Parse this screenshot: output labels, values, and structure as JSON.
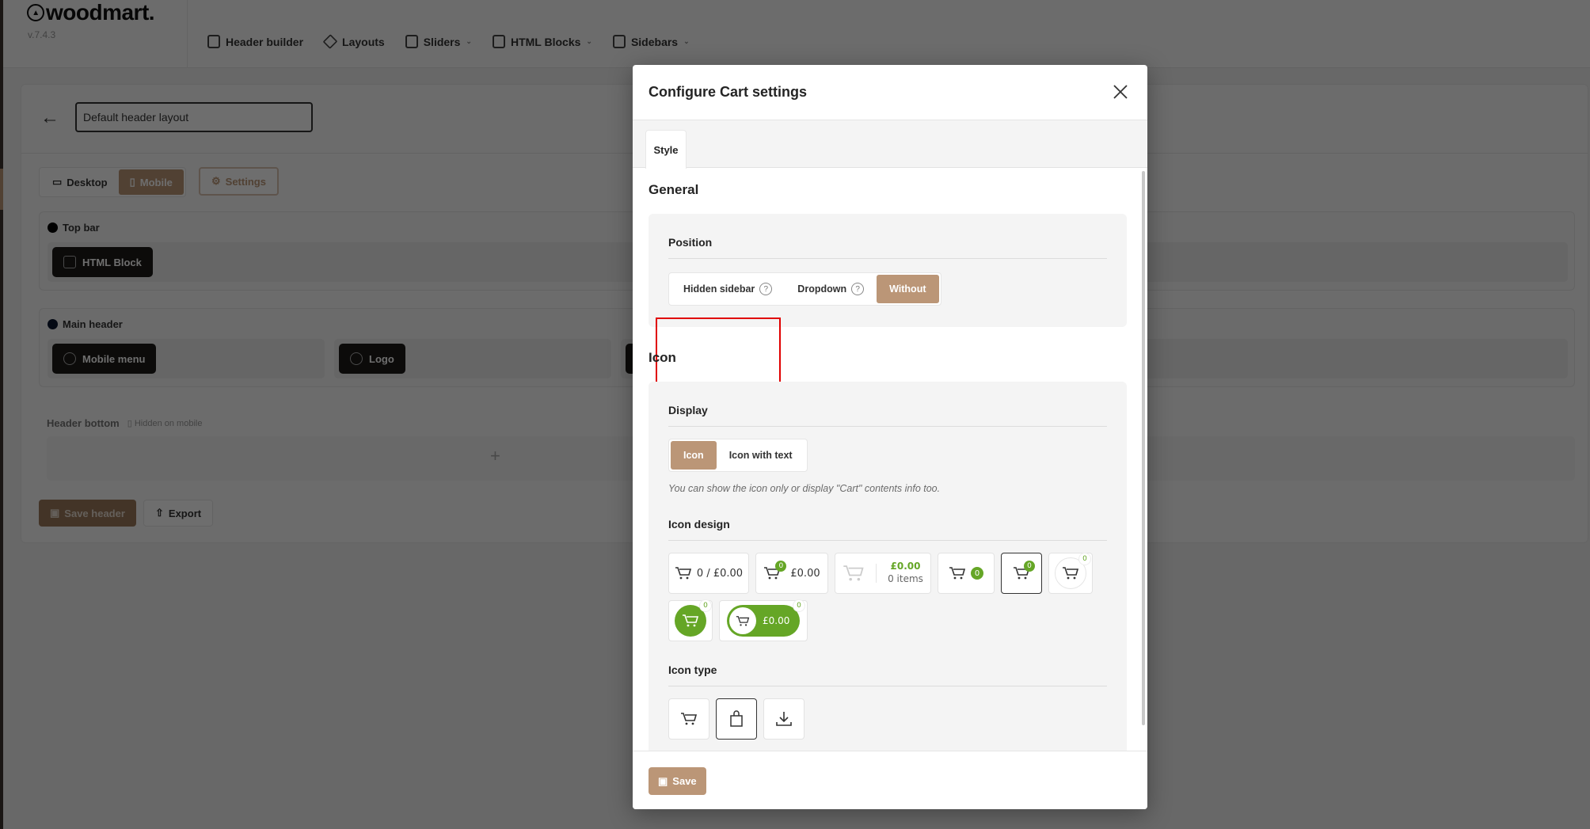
{
  "app": {
    "brand": "woodmart.",
    "version": "v.7.4.3",
    "nav": [
      {
        "label": "Header builder",
        "icon": "header-builder-icon",
        "has_dropdown": false
      },
      {
        "label": "Layouts",
        "icon": "layers-icon",
        "has_dropdown": false
      },
      {
        "label": "Sliders",
        "icon": "sliders-icon",
        "has_dropdown": true
      },
      {
        "label": "HTML Blocks",
        "icon": "html-block-icon",
        "has_dropdown": true
      },
      {
        "label": "Sidebars",
        "icon": "sidebar-icon",
        "has_dropdown": true
      }
    ],
    "caret": "⌄"
  },
  "builder": {
    "back_icon": "←",
    "layout_name": "Default header layout",
    "device_tabs": [
      {
        "label": "Desktop",
        "active": false
      },
      {
        "label": "Mobile",
        "active": true
      }
    ],
    "settings_label": "Settings",
    "rows": [
      {
        "title": "Top bar",
        "elements": [
          "HTML Block"
        ]
      },
      {
        "title": "Main header",
        "elements": [
          "Mobile menu",
          "Logo"
        ]
      }
    ],
    "header_bottom": {
      "title": "Header bottom",
      "note": "Hidden on mobile",
      "add": "+"
    },
    "save_header_label": "Save header",
    "export_label": "Export"
  },
  "modal": {
    "title": "Configure Cart settings",
    "close_icon": "×",
    "tabs": [
      {
        "label": "Style",
        "active": true
      }
    ],
    "sections": {
      "general": {
        "title": "General",
        "position": {
          "label": "Position",
          "options": [
            {
              "label": "Hidden sidebar",
              "help": "?",
              "selected": false
            },
            {
              "label": "Dropdown",
              "help": "?",
              "selected": false
            },
            {
              "label": "Without",
              "selected": true
            }
          ]
        }
      },
      "icon": {
        "title": "Icon",
        "display": {
          "label": "Display",
          "options": [
            {
              "label": "Icon",
              "selected": true
            },
            {
              "label": "Icon with text",
              "selected": false
            }
          ],
          "hint": "You can show the icon only or display \"Cart\" contents info too."
        },
        "design": {
          "label": "Icon design",
          "options": [
            {
              "style": "count-slash-total",
              "count": "0",
              "sep": "/",
              "total": "£0.00",
              "selected": false
            },
            {
              "style": "badge-total",
              "count": "0",
              "total": "£0.00",
              "selected": false
            },
            {
              "style": "total-items",
              "total": "£0.00",
              "items": "0 items",
              "selected": false
            },
            {
              "style": "inline-badge",
              "count": "0",
              "selected": false
            },
            {
              "style": "corner-badge",
              "count": "0",
              "selected": true
            },
            {
              "style": "circle-outline",
              "count": "0",
              "selected": false
            },
            {
              "style": "circle-filled",
              "count": "0",
              "selected": false
            },
            {
              "style": "pill-filled",
              "count": "0",
              "total": "£0.00",
              "selected": false
            }
          ]
        },
        "type": {
          "label": "Icon type",
          "options": [
            {
              "icon": "cart-icon",
              "selected": false
            },
            {
              "icon": "shopping-bag-icon",
              "selected": true
            },
            {
              "icon": "download-icon",
              "selected": false
            }
          ]
        }
      }
    },
    "save_label": "Save"
  },
  "colors": {
    "accent": "#bb9677",
    "green": "#65a626",
    "highlight": "#e00000"
  }
}
